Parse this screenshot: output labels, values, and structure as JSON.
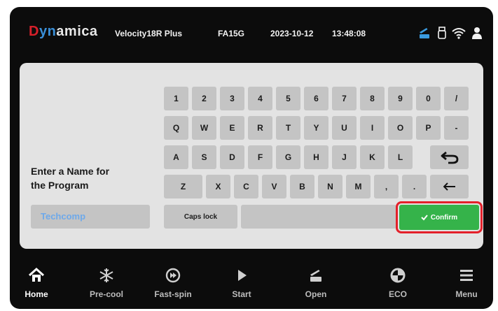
{
  "status_bar": {
    "logo": {
      "part1": "D",
      "part2": "yn",
      "part3": "amica"
    },
    "model": "Velocity18R Plus",
    "serial": "FA15G",
    "date": "2023-10-12",
    "time": "13:48:08",
    "icons": [
      "lid-open-icon",
      "usb-icon",
      "wifi-icon",
      "user-icon"
    ]
  },
  "keyboard": {
    "prompt": "Enter a Name for\nthe Program",
    "name_value": "Techcomp",
    "rows": [
      [
        "1",
        "2",
        "3",
        "4",
        "5",
        "6",
        "7",
        "8",
        "9",
        "0",
        "/"
      ],
      [
        "Q",
        "W",
        "E",
        "R",
        "T",
        "Y",
        "U",
        "I",
        "O",
        "P",
        "-"
      ],
      [
        "A",
        "S",
        "D",
        "F",
        "G",
        "H",
        "J",
        "K",
        "L"
      ],
      [
        "Z",
        "X",
        "C",
        "V",
        "B",
        "N",
        "M",
        ",",
        "."
      ]
    ],
    "caps_label": "Caps lock",
    "confirm_label": "Confirm",
    "colors": {
      "confirm": "#35b34a",
      "highlight": "#e4202a",
      "field_text": "#6ea9ea"
    }
  },
  "nav": {
    "items": [
      {
        "label": "Home",
        "icon": "home-icon"
      },
      {
        "label": "Pre-cool",
        "icon": "snowflake-icon"
      },
      {
        "label": "Fast-spin",
        "icon": "fast-spin-icon"
      },
      {
        "label": "Start",
        "icon": "play-icon"
      },
      {
        "label": "Open",
        "icon": "lid-open-icon"
      },
      {
        "label": "ECO",
        "icon": "eco-icon"
      },
      {
        "label": "Menu",
        "icon": "menu-icon"
      }
    ]
  }
}
